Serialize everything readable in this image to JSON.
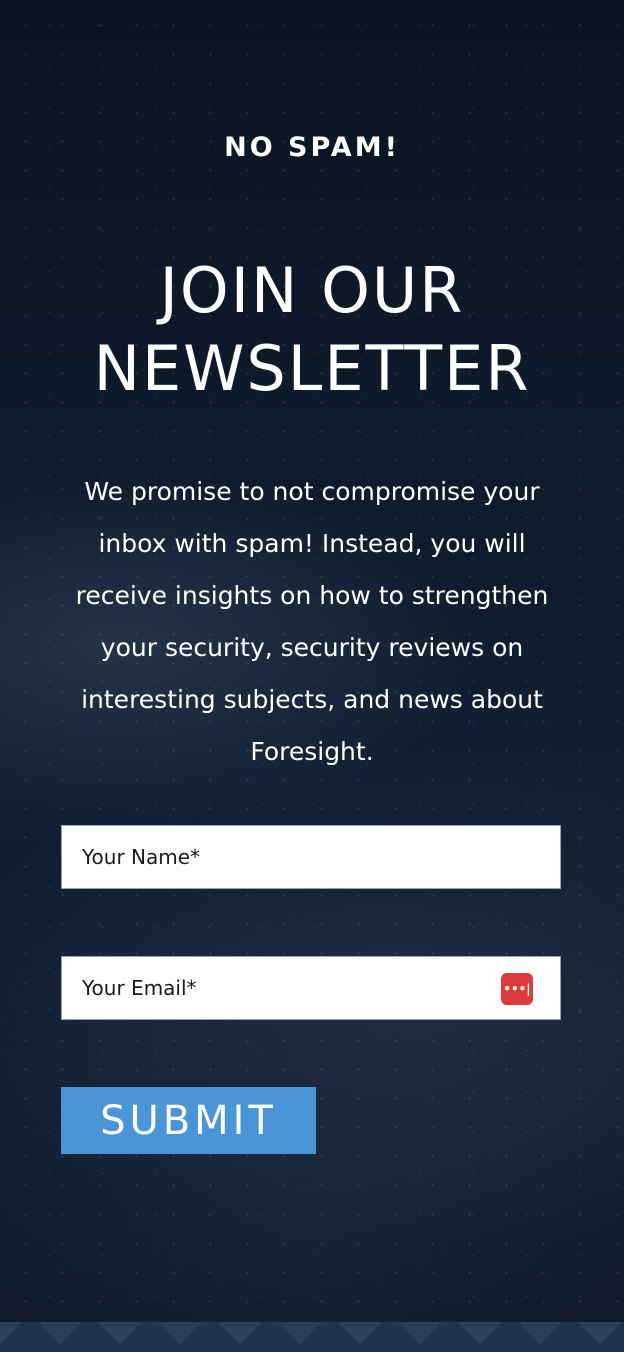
{
  "newsletter": {
    "eyebrow": "NO SPAM!",
    "title": "JOIN OUR NEWSLETTER",
    "description": "We promise to not compromise your inbox with spam! Instead, you will receive insights on how to strengthen your security, security reviews on interesting subjects, and news about Foresight.",
    "name_placeholder": "Your Name*",
    "email_placeholder": "Your Email*",
    "password_manager_icon": "password-manager-icon",
    "password_manager_icon_text": "•••|",
    "submit_label": "SUBMIT"
  },
  "colors": {
    "background": "#0c1526",
    "accent": "#4a95d6",
    "icon_red": "#dc3b3b",
    "footer": "#1e3552"
  }
}
